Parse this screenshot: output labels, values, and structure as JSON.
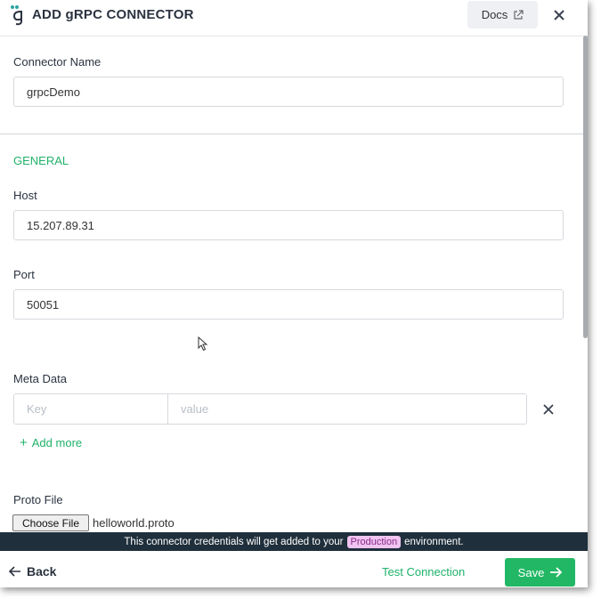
{
  "header": {
    "title": "ADD gRPC CONNECTOR",
    "docs_label": "Docs",
    "icons": [
      "grpc-logo-icon",
      "external-link-icon",
      "close-icon"
    ]
  },
  "form": {
    "connector_name": {
      "label": "Connector Name",
      "value": "grpcDemo"
    },
    "section_title": "GENERAL",
    "host": {
      "label": "Host",
      "value": "15.207.89.31"
    },
    "port": {
      "label": "Port",
      "value": "50051"
    },
    "meta_data": {
      "label": "Meta Data",
      "key_placeholder": "Key",
      "value_placeholder": "value",
      "add_more_label": "Add more"
    },
    "proto_file": {
      "label": "Proto File",
      "choose_file_label": "Choose File",
      "file_name": "helloworld.proto"
    }
  },
  "banner": {
    "text_before": "This connector credentials will get added to your",
    "environment": "Production",
    "text_after": "environment."
  },
  "footer": {
    "back_label": "Back",
    "test_connection_label": "Test Connection",
    "save_label": "Save"
  },
  "colors": {
    "accent": "#1fb26a",
    "save_button": "#22b764",
    "banner_bg": "#1f2f3b",
    "env_badge_bg": "#f0c4f0"
  }
}
